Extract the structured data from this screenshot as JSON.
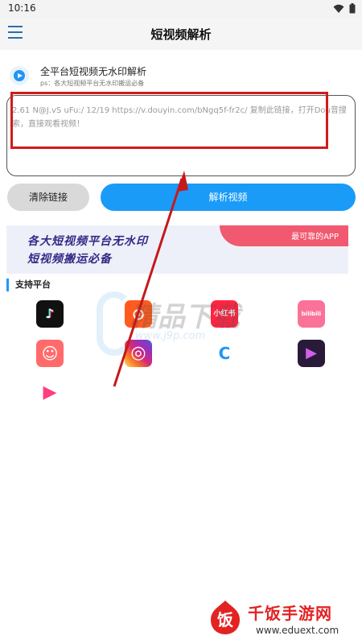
{
  "status": {
    "time": "10:16"
  },
  "appbar": {
    "title": "短视频解析"
  },
  "header": {
    "title": "全平台短视频无水印解析",
    "subtitle": "ps：各大短视频平台无水印搬运必备"
  },
  "input": {
    "text": "2.61 N@J.vS uFu:/ 12/19  https://v.douyin.com/bNgq5f-fr2c/ 复制此链接，打开Dou音搜索，直接观看视频！"
  },
  "buttons": {
    "clear": "清除链接",
    "parse": "解析视频"
  },
  "banner": {
    "line1": "各大短视频平台无水印",
    "line2": "短视频搬运必备",
    "badge": "最可靠的APP"
  },
  "platforms_title": "支持平台",
  "platforms": [
    {
      "name": "tiktok",
      "glyph": "♪"
    },
    {
      "name": "kuaishou",
      "glyph": "⊙"
    },
    {
      "name": "xiaohongshu",
      "glyph": "小红书"
    },
    {
      "name": "bilibili",
      "glyph": "bilibili"
    },
    {
      "name": "pipixia",
      "glyph": "☺"
    },
    {
      "name": "instagram",
      "glyph": "◎"
    },
    {
      "name": "lvzhou",
      "glyph": "C"
    },
    {
      "name": "weishi",
      "glyph": "▶"
    },
    {
      "name": "haokan",
      "glyph": "▶"
    }
  ],
  "watermark": {
    "text": "精品下载",
    "url": "www.j9p.com"
  },
  "footer": {
    "brand": "千饭手游网",
    "url": "www.eduext.com"
  },
  "colors": {
    "accent": "#1a9bf8",
    "highlight_box": "#d21a1a",
    "banner_pink": "#f0596f",
    "banner_text": "#352a87"
  }
}
